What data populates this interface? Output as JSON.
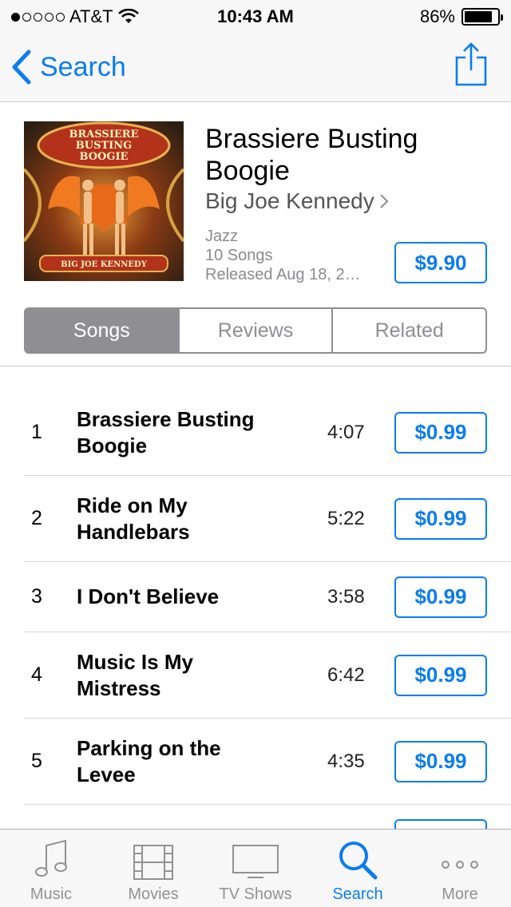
{
  "status_bar": {
    "carrier": "AT&T",
    "time": "10:43 AM",
    "battery": "86%",
    "battery_level": 0.86
  },
  "nav": {
    "back_label": "Search"
  },
  "album": {
    "title": "Brassiere Busting Boogie",
    "artist": "Big Joe Kennedy",
    "genre": "Jazz",
    "song_count": "10 Songs",
    "released": "Released Aug 18, 2…",
    "price": "$9.90",
    "cover_top_text": [
      "BRASSIERE",
      "BUSTING",
      "BOOGIE"
    ],
    "cover_bottom_text": "BIG JOE KENNEDY"
  },
  "segments": [
    "Songs",
    "Reviews",
    "Related"
  ],
  "songs": [
    {
      "num": "1",
      "title": "Brassiere Busting Boogie",
      "duration": "4:07",
      "price": "$0.99"
    },
    {
      "num": "2",
      "title": "Ride on My Handlebars",
      "duration": "5:22",
      "price": "$0.99"
    },
    {
      "num": "3",
      "title": "I Don't Believe",
      "duration": "3:58",
      "price": "$0.99"
    },
    {
      "num": "4",
      "title": "Music Is My Mistress",
      "duration": "6:42",
      "price": "$0.99"
    },
    {
      "num": "5",
      "title": "Parking on the Levee",
      "duration": "4:35",
      "price": "$0.99"
    }
  ],
  "tabs": [
    "Music",
    "Movies",
    "TV Shows",
    "Search",
    "More"
  ],
  "colors": {
    "accent": "#0a7cf0",
    "segment_gray": "#8e8e93"
  }
}
